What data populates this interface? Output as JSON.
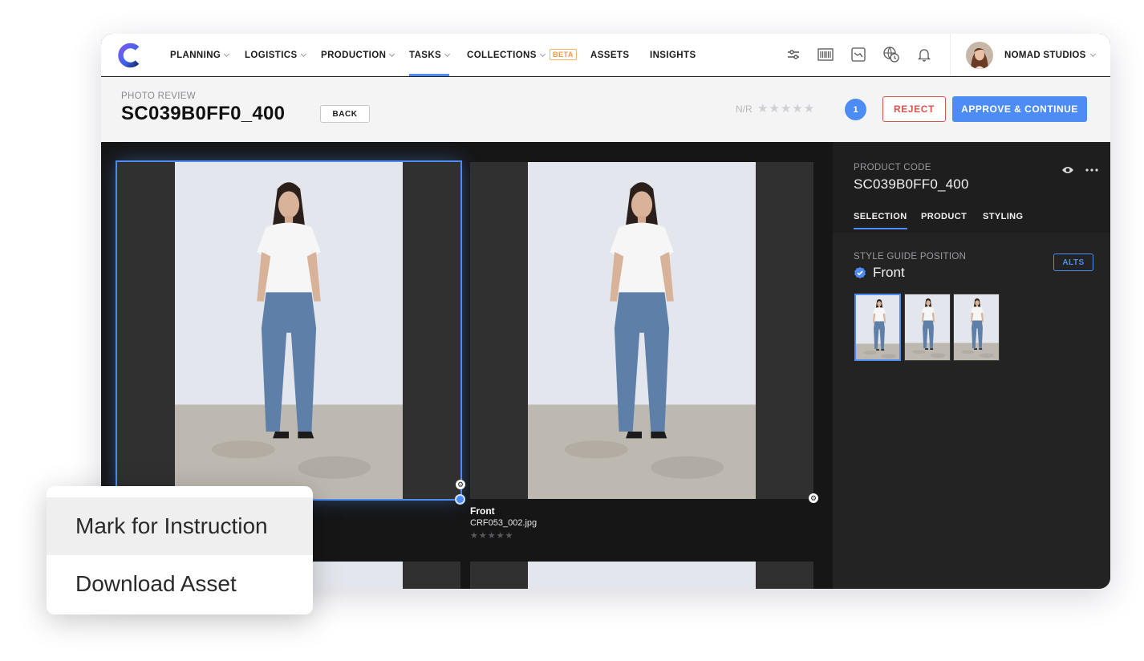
{
  "nav": {
    "items": [
      {
        "label": "PLANNING",
        "has_dropdown": true
      },
      {
        "label": "LOGISTICS",
        "has_dropdown": true
      },
      {
        "label": "PRODUCTION",
        "has_dropdown": true
      },
      {
        "label": "TASKS",
        "has_dropdown": true,
        "active": true
      },
      {
        "label": "COLLECTIONS",
        "has_dropdown": true
      },
      {
        "label": "ASSETS",
        "has_dropdown": false
      },
      {
        "label": "INSIGHTS",
        "has_dropdown": false
      }
    ],
    "beta_badge": "BETA",
    "tool_icons": [
      "sliders-icon",
      "barcode-icon",
      "chart-icon",
      "world-clock-icon",
      "bell-icon"
    ],
    "studio_name": "NOMAD STUDIOS"
  },
  "header": {
    "eyebrow": "PHOTO REVIEW",
    "title": "SC039B0FF0_400",
    "back_label": "BACK",
    "rating_label": "N/R",
    "rating_stars": "★★★★★",
    "count": "1",
    "reject_label": "REJECT",
    "approve_label": "APPROVE & CONTINUE"
  },
  "assets": [
    {
      "selected": true
    },
    {
      "title": "Front",
      "filename": "CRF053_002.jpg",
      "stars": "★★★★★"
    }
  ],
  "panel": {
    "product_code_label": "PRODUCT CODE",
    "product_code": "SC039B0FF0_400",
    "tabs": [
      {
        "label": "SELECTION",
        "active": true
      },
      {
        "label": "PRODUCT",
        "active": false
      },
      {
        "label": "STYLING",
        "active": false
      }
    ],
    "style_guide_label": "STYLE GUIDE POSITION",
    "style_guide_value": "Front",
    "alts_label": "ALTS"
  },
  "context_menu": {
    "items": [
      "Mark for Instruction",
      "Download Asset"
    ]
  },
  "colors": {
    "accent": "#4d8bf5",
    "reject": "#d9534f",
    "beta": "#ee9b3a"
  }
}
